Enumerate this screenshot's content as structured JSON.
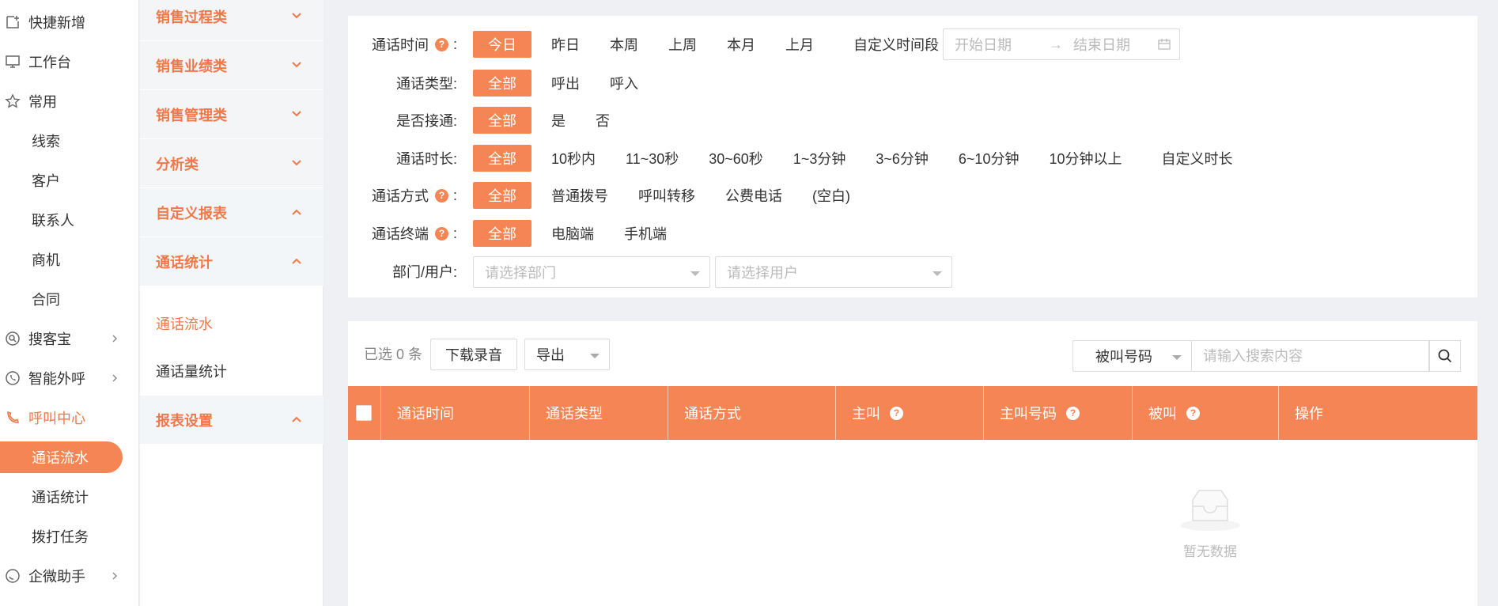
{
  "nav": {
    "quick_add": "快捷新增",
    "workbench": "工作台",
    "common": "常用",
    "sub_leads": "线索",
    "sub_customers": "客户",
    "sub_contacts": "联系人",
    "sub_opportunities": "商机",
    "sub_contracts": "合同",
    "souke": "搜客宝",
    "smart_call": "智能外呼",
    "call_center": "呼叫中心",
    "call_records": "通话流水",
    "call_stats": "通话统计",
    "dial_tasks": "拨打任务",
    "wecom": "企微助手"
  },
  "reports": {
    "groups": [
      "销售过程类",
      "销售业绩类",
      "销售管理类",
      "分析类",
      "自定义报表",
      "通话统计",
      "报表设置"
    ],
    "links": [
      "通话流水",
      "通话量统计"
    ]
  },
  "filters": {
    "call_time": {
      "label": "通话时间",
      "options": [
        "今日",
        "昨日",
        "本周",
        "上周",
        "本月",
        "上月"
      ],
      "custom_label": "自定义时间段",
      "start_placeholder": "开始日期",
      "end_placeholder": "结束日期",
      "range_arrow": "→"
    },
    "call_type": {
      "label": "通话类型:",
      "options": [
        "全部",
        "呼出",
        "呼入"
      ]
    },
    "connected": {
      "label": "是否接通:",
      "options": [
        "全部",
        "是",
        "否"
      ]
    },
    "duration": {
      "label": "通话时长:",
      "options": [
        "全部",
        "10秒内",
        "11~30秒",
        "30~60秒",
        "1~3分钟",
        "3~6分钟",
        "6~10分钟",
        "10分钟以上",
        "自定义时长"
      ]
    },
    "method": {
      "label": "通话方式",
      "options": [
        "全部",
        "普通拨号",
        "呼叫转移",
        "公费电话",
        "(空白)"
      ]
    },
    "terminal": {
      "label": "通话终端",
      "options": [
        "全部",
        "电脑端",
        "手机端"
      ]
    },
    "dept_user": {
      "label": "部门/用户:",
      "dept_placeholder": "请选择部门",
      "user_placeholder": "请选择用户"
    }
  },
  "list": {
    "selected": "已选 0 条",
    "download_btn": "下载录音",
    "export_btn": "导出",
    "search_field": "被叫号码",
    "search_placeholder": "请输入搜索内容",
    "columns": [
      "通话时间",
      "通话类型",
      "通话方式",
      "主叫",
      "主叫号码",
      "被叫",
      "操作"
    ],
    "empty": "暂无数据"
  },
  "colors": {
    "accent": "#f58554",
    "accent_text": "#f0784a"
  }
}
